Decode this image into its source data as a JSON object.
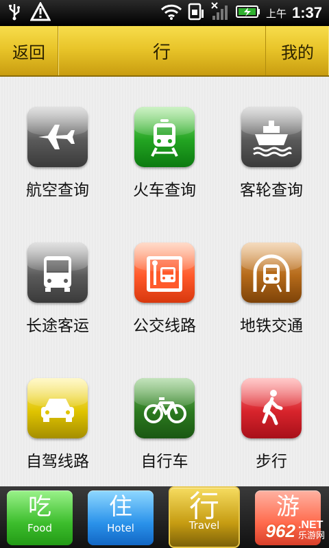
{
  "status_bar": {
    "icons": [
      "usb-icon",
      "warning-icon",
      "wifi-icon",
      "sim-icon",
      "signal-icon",
      "battery-charging-icon"
    ],
    "ampm": "上午",
    "time": "1:37"
  },
  "titlebar": {
    "back_label": "返回",
    "title": "行",
    "mine_label": "我的"
  },
  "grid": [
    {
      "label": "航空查询",
      "icon": "airplane-icon",
      "color": "#5a5a5a"
    },
    {
      "label": "火车查询",
      "icon": "train-icon",
      "color": "#23a422"
    },
    {
      "label": "客轮查询",
      "icon": "ship-icon",
      "color": "#5a5a5a"
    },
    {
      "label": "长途客运",
      "icon": "bus-icon",
      "color": "#5a5a5a"
    },
    {
      "label": "公交线路",
      "icon": "bus-stop-icon",
      "color": "#ff5a2b"
    },
    {
      "label": "地铁交通",
      "icon": "subway-icon",
      "color": "#b56a1a"
    },
    {
      "label": "自驾线路",
      "icon": "car-icon",
      "color": "#e0c400"
    },
    {
      "label": "自行车",
      "icon": "bicycle-icon",
      "color": "#2c7a20"
    },
    {
      "label": "步行",
      "icon": "walking-icon",
      "color": "#d8242c"
    }
  ],
  "tabs": [
    {
      "cn": "吃",
      "en": "Food"
    },
    {
      "cn": "住",
      "en": "Hotel"
    },
    {
      "cn": "行",
      "en": "Travel"
    },
    {
      "cn": "游",
      "en": ""
    }
  ],
  "watermark": {
    "logo": "962",
    "net": ".NET",
    "site": "乐游网"
  }
}
